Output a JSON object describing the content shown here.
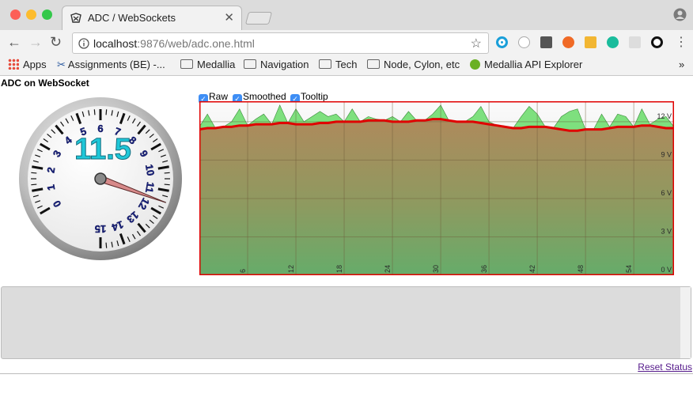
{
  "browser": {
    "tab_title": "ADC / WebSockets",
    "url_host": "localhost",
    "url_rest": ":9876/web/adc.one.html",
    "bookmarks": [
      "Apps",
      "Assignments (BE) -...",
      "Medallia",
      "Navigation",
      "Tech",
      "Node, Cylon, etc",
      "Medallia API Explorer"
    ],
    "bookmarks_more": "»",
    "traffic_lights": [
      "#fc5f57",
      "#fdbc2e",
      "#34c84a"
    ]
  },
  "page": {
    "title": "ADC on WebSocket",
    "checkboxes": [
      {
        "label": "Raw",
        "checked": true
      },
      {
        "label": "Smoothed",
        "checked": true
      },
      {
        "label": "Tooltip",
        "checked": true
      }
    ],
    "reset_label": "Reset Status"
  },
  "gauge": {
    "value": 11.5,
    "value_text": "11.5",
    "min": 0,
    "max": 15,
    "tick_labels": [
      "0",
      "1",
      "2",
      "3",
      "4",
      "5",
      "6",
      "7",
      "8",
      "9",
      "10",
      "11",
      "12",
      "13",
      "14",
      "15"
    ]
  },
  "chart_data": {
    "type": "area",
    "y_axis_labels": [
      "0 V",
      "3 V",
      "6 V",
      "9 V",
      "12 V"
    ],
    "ylim": [
      0,
      13.6
    ],
    "x_tick_labels": [
      "6",
      "12",
      "18",
      "24",
      "30",
      "36",
      "42",
      "48",
      "54"
    ],
    "x_ticks": [
      6,
      12,
      18,
      24,
      30,
      36,
      42,
      48,
      54
    ],
    "xlim": [
      0,
      59
    ],
    "series": [
      {
        "values": [
          11.6,
          12.6,
          10.8,
          11.2,
          12.0,
          13.0,
          11.6,
          12.2,
          12.6,
          11.0,
          13.3,
          11.3,
          13.0,
          12.0,
          12.4,
          12.8,
          12.4,
          12.6,
          11.4,
          13.0,
          12.0,
          12.4,
          12.2,
          11.8,
          12.4,
          11.2,
          12.8,
          12.0,
          10.4,
          12.6,
          13.3,
          11.8,
          11.6,
          12.0,
          12.4,
          13.2,
          12.0,
          11.4,
          10.6,
          11.2,
          12.4,
          13.2,
          12.6,
          11.0,
          11.4,
          12.4,
          12.8,
          13.0,
          11.0,
          10.2,
          12.6,
          11.6,
          12.6,
          12.4,
          10.8,
          13.0,
          11.8,
          12.2,
          12.4,
          11.6
        ]
      },
      {
        "values": [
          11.4,
          11.5,
          11.5,
          11.6,
          11.6,
          11.7,
          11.7,
          11.8,
          11.8,
          11.8,
          11.9,
          11.9,
          11.8,
          11.8,
          11.8,
          11.9,
          11.9,
          12.0,
          12.0,
          12.0,
          12.0,
          12.1,
          12.1,
          12.1,
          12.0,
          12.0,
          12.0,
          12.1,
          12.1,
          12.2,
          12.2,
          12.1,
          12.0,
          12.0,
          12.0,
          11.9,
          11.8,
          11.7,
          11.6,
          11.5,
          11.5,
          11.6,
          11.6,
          11.6,
          11.5,
          11.4,
          11.3,
          11.3,
          11.4,
          11.4,
          11.4,
          11.5,
          11.6,
          11.6,
          11.6,
          11.7,
          11.7,
          11.6,
          11.5,
          11.5
        ]
      }
    ],
    "colors": {
      "raw_above": "#7ee07e",
      "raw_below": "#e89a9a",
      "smoothed": "#e00000",
      "border": "#e00000"
    }
  }
}
